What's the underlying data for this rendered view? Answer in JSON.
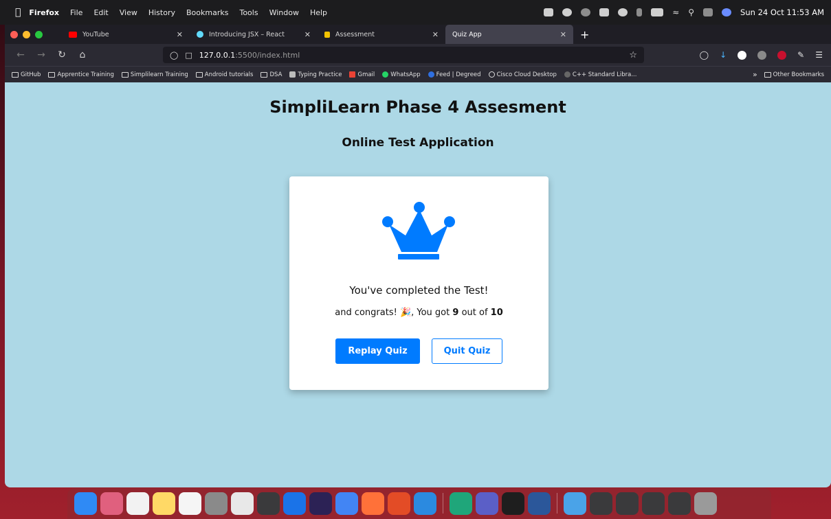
{
  "menubar": {
    "app_name": "Firefox",
    "menus": [
      "File",
      "Edit",
      "View",
      "History",
      "Bookmarks",
      "Tools",
      "Window",
      "Help"
    ],
    "clock": "Sun 24 Oct  11:53 AM"
  },
  "tabs": [
    {
      "label": "YouTube",
      "favicon_color": "#ff0000"
    },
    {
      "label": "Introducing JSX – React",
      "favicon_color": "#61dafb"
    },
    {
      "label": "Assessment",
      "favicon_color": "#f2c200"
    },
    {
      "label": "Quiz App",
      "favicon_color": "#42414d"
    }
  ],
  "toolbar": {
    "url_host": "127.0.0.1",
    "url_path": ":5500/index.html"
  },
  "bookmarks": {
    "items": [
      "GitHub",
      "Apprentice Training",
      "Simplilearn Training",
      "Android tutorials",
      "DSA",
      "Typing Practice",
      "Gmail",
      "WhatsApp",
      "Feed | Degreed",
      "Cisco Cloud Desktop",
      "C++ Standard Libra..."
    ],
    "overflow": "»",
    "other": "Other Bookmarks"
  },
  "page": {
    "title": "SimpliLearn Phase 4 Assesment",
    "subtitle": "Online Test Application"
  },
  "result": {
    "completed_text": "You've completed the Test!",
    "congrats_prefix": "and congrats! 🎉, You got",
    "score": "9",
    "out_of_text": "out of",
    "total": "10",
    "accent_color": "#007bff"
  },
  "buttons": {
    "replay_label": "Replay Quiz",
    "quit_label": "Quit Quiz"
  }
}
